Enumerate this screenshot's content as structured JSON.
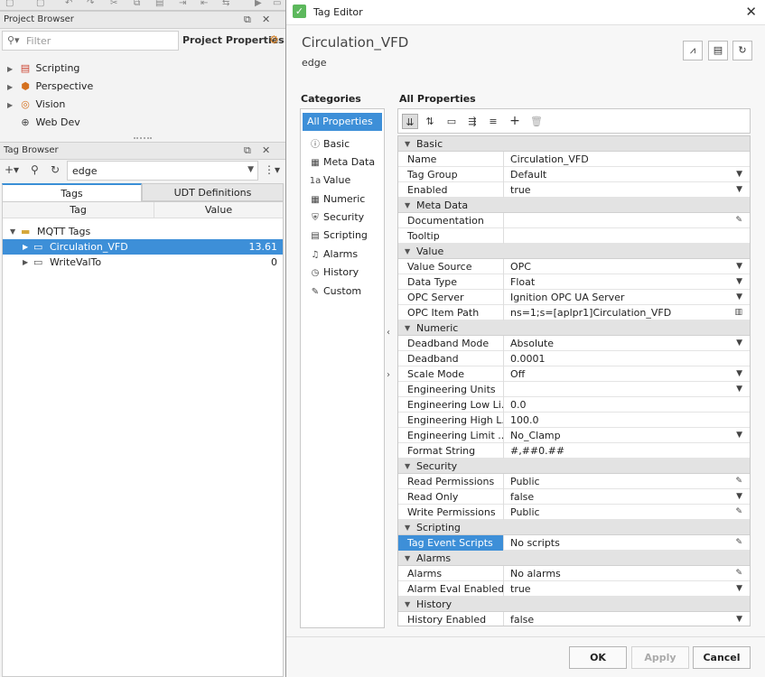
{
  "project_browser": {
    "title": "Project Browser",
    "filter_placeholder": "Filter",
    "project_properties": "Project Properties",
    "items": [
      {
        "label": "Scripting"
      },
      {
        "label": "Perspective"
      },
      {
        "label": "Vision"
      },
      {
        "label": "Web Dev"
      }
    ]
  },
  "tag_browser": {
    "title": "Tag Browser",
    "provider": "edge",
    "tabs": [
      "Tags",
      "UDT Definitions"
    ],
    "columns": [
      "Tag",
      "Value"
    ],
    "folder": "MQTT Tags",
    "rows": [
      {
        "tag": "Circulation_VFD",
        "value": "13.61"
      },
      {
        "tag": "WriteValTo",
        "value": "0"
      }
    ]
  },
  "dialog": {
    "window_title": "Tag Editor",
    "tag_name": "Circulation_VFD",
    "provider": "edge",
    "categories_heading": "Categories",
    "all_properties_heading": "All Properties",
    "categories": [
      "All Properties",
      "Basic",
      "Meta Data",
      "Value",
      "Numeric",
      "Security",
      "Scripting",
      "Alarms",
      "History",
      "Custom"
    ],
    "groups": [
      {
        "name": "Basic",
        "rows": [
          {
            "name": "Name",
            "value": "Circulation_VFD",
            "editor": ""
          },
          {
            "name": "Tag Group",
            "value": "Default",
            "editor": "dropdown"
          },
          {
            "name": "Enabled",
            "value": "true",
            "editor": "dropdown"
          }
        ]
      },
      {
        "name": "Meta Data",
        "rows": [
          {
            "name": "Documentation",
            "value": "",
            "editor": "pencil"
          },
          {
            "name": "Tooltip",
            "value": "",
            "editor": ""
          }
        ]
      },
      {
        "name": "Value",
        "rows": [
          {
            "name": "Value Source",
            "value": "OPC",
            "editor": "dropdown"
          },
          {
            "name": "Data Type",
            "value": "Float",
            "editor": "dropdown"
          },
          {
            "name": "OPC Server",
            "value": "Ignition OPC UA Server",
            "editor": "dropdown"
          },
          {
            "name": "OPC Item Path",
            "value": "ns=1;s=[aplpr1]Circulation_VFD",
            "editor": "browse"
          }
        ]
      },
      {
        "name": "Numeric",
        "rows": [
          {
            "name": "Deadband Mode",
            "value": "Absolute",
            "editor": "dropdown"
          },
          {
            "name": "Deadband",
            "value": "0.0001",
            "editor": ""
          },
          {
            "name": "Scale Mode",
            "value": "Off",
            "editor": "dropdown"
          },
          {
            "name": "Engineering Units",
            "value": "",
            "editor": "dropdown"
          },
          {
            "name": "Engineering Low Li...",
            "value": "0.0",
            "editor": ""
          },
          {
            "name": "Engineering High L...",
            "value": "100.0",
            "editor": ""
          },
          {
            "name": "Engineering Limit ...",
            "value": "No_Clamp",
            "editor": "dropdown"
          },
          {
            "name": "Format String",
            "value": "#,##0.##",
            "editor": ""
          }
        ]
      },
      {
        "name": "Security",
        "rows": [
          {
            "name": "Read Permissions",
            "value": "Public",
            "editor": "pencil"
          },
          {
            "name": "Read Only",
            "value": "false",
            "editor": "dropdown"
          },
          {
            "name": "Write Permissions",
            "value": "Public",
            "editor": "pencil"
          }
        ]
      },
      {
        "name": "Scripting",
        "rows": [
          {
            "name": "Tag Event Scripts",
            "value": "No scripts",
            "editor": "pencil",
            "selected": true
          }
        ]
      },
      {
        "name": "Alarms",
        "rows": [
          {
            "name": "Alarms",
            "value": "No alarms",
            "editor": "pencil"
          },
          {
            "name": "Alarm Eval Enabled",
            "value": "true",
            "editor": "dropdown"
          }
        ]
      },
      {
        "name": "History",
        "rows": [
          {
            "name": "History Enabled",
            "value": "false",
            "editor": "dropdown"
          }
        ]
      }
    ],
    "buttons": {
      "ok": "OK",
      "apply": "Apply",
      "cancel": "Cancel"
    }
  },
  "colors": {
    "selection": "#3d8fd8",
    "check": "#5cb85c"
  }
}
